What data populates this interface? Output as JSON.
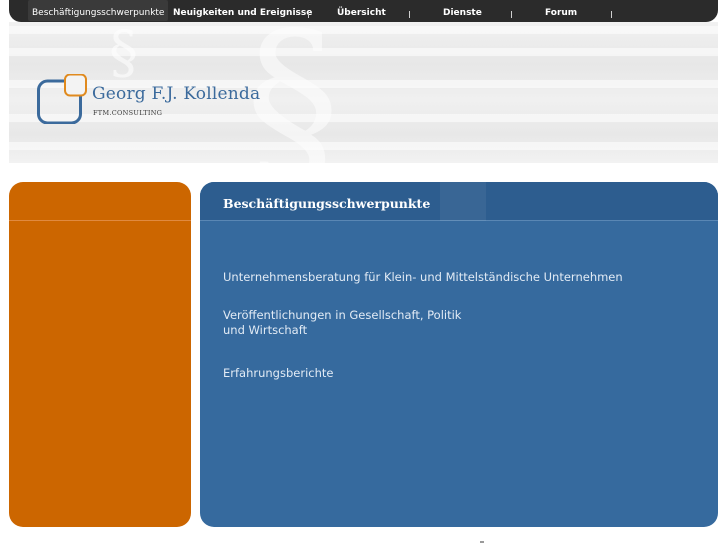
{
  "nav": {
    "items": [
      {
        "label": "Beschäftigungsschwerpunkte"
      },
      {
        "label": "Neuigkeiten und Ereignisse"
      },
      {
        "label": "Übersicht"
      },
      {
        "label": "Dienste"
      },
      {
        "label": "Forum"
      }
    ]
  },
  "header": {
    "logo_name": "Georg F.J. Kollenda",
    "logo_subtitle": "FTM.CONSULTING",
    "decoration_glyph": "§"
  },
  "content": {
    "title": "Beschäftigungsschwerpunkte",
    "links": [
      {
        "line1": "Unternehmensberatung für Klein- und Mittelständische Unternehmen"
      },
      {
        "line1": "Veröffentlichungen in Gesellschaft, Politik",
        "line2": "und Wirtschaft"
      },
      {
        "line1": "Erfahrungsberichte"
      }
    ]
  },
  "colors": {
    "nav_bg": "#2b2b2b",
    "sidebar_orange": "#cc6600",
    "panel_blue": "#366a9e",
    "logo_blue": "#3b6a9c",
    "logo_orange": "#e08a1e"
  }
}
